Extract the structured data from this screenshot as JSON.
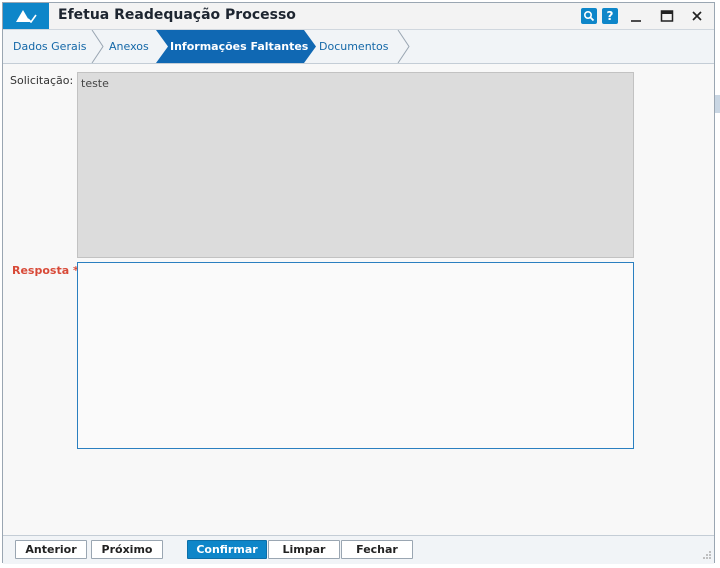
{
  "window": {
    "title": "Efetua Readequação Processo"
  },
  "titlebar": {
    "search_icon": "search-icon",
    "help_icon": "help-icon",
    "help_label": "?"
  },
  "tabs": [
    {
      "label": "Dados Gerais",
      "active": false
    },
    {
      "label": "Anexos",
      "active": false
    },
    {
      "label": "Informações Faltantes",
      "active": true
    },
    {
      "label": "Documentos",
      "active": false
    }
  ],
  "form": {
    "solicitacao_label": "Solicitação:",
    "solicitacao_value": "teste",
    "resposta_label": "Resposta *",
    "resposta_value": "",
    "mic_icon": "microphone-icon"
  },
  "footer": {
    "anterior": "Anterior",
    "proximo": "Próximo",
    "confirmar": "Confirmar",
    "limpar": "Limpar",
    "fechar": "Fechar"
  },
  "colors": {
    "accent": "#0e86c9",
    "active_tab": "#1068b3",
    "required": "#d84a38"
  }
}
